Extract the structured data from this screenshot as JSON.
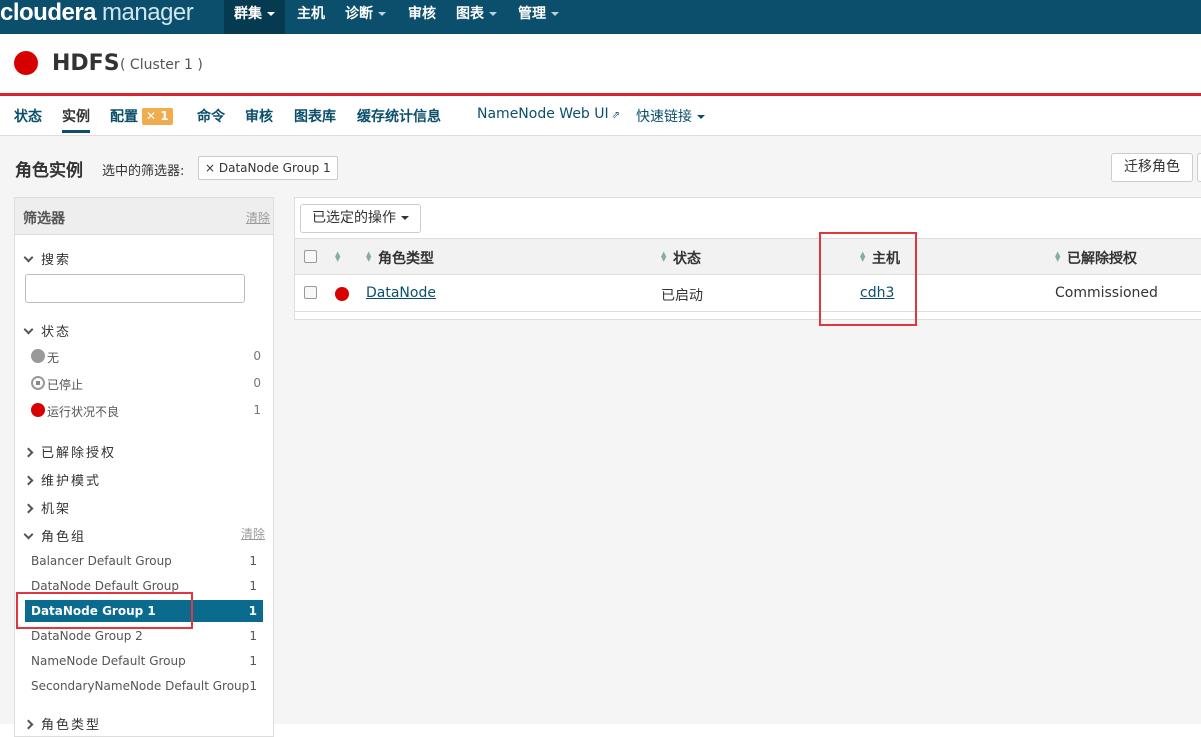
{
  "nav": {
    "brand_main": "cloudera",
    "brand_sub": "manager",
    "items": [
      {
        "label": "群集",
        "has_caret": true,
        "active": true
      },
      {
        "label": "主机",
        "has_caret": false,
        "active": false
      },
      {
        "label": "诊断",
        "has_caret": true,
        "active": false
      },
      {
        "label": "审核",
        "has_caret": false,
        "active": false
      },
      {
        "label": "图表",
        "has_caret": true,
        "active": false
      },
      {
        "label": "管理",
        "has_caret": true,
        "active": false
      }
    ]
  },
  "service": {
    "name": "HDFS",
    "cluster": "( Cluster 1 )",
    "status_color": "#d60000"
  },
  "tabs": {
    "status": "状态",
    "instances": "实例",
    "config": "配置",
    "config_badge": "1",
    "commands": "命令",
    "audit": "审核",
    "charts_lib": "图表库",
    "cache_stats": "缓存统计信息",
    "namenode_ui": "NameNode Web UI",
    "quick_links": "快速链接"
  },
  "page": {
    "title": "角色实例",
    "selected_filters_label": "选中的筛选器:",
    "filter_chip": "× DataNode Group 1",
    "migrate_button": "迁移角色"
  },
  "sidebar": {
    "title": "筛选器",
    "clear": "清除",
    "search_label": "搜索",
    "search_value": "",
    "status_label": "状态",
    "status_items": [
      {
        "label": "无",
        "count": "0",
        "kind": "gray"
      },
      {
        "label": "已停止",
        "count": "0",
        "kind": "stopped"
      },
      {
        "label": "运行状况不良",
        "count": "1",
        "kind": "red"
      }
    ],
    "decommission_label": "已解除授权",
    "maintenance_label": "维护模式",
    "rack_label": "机架",
    "role_group_label": "角色组",
    "role_group_clear": "清除",
    "role_groups": [
      {
        "label": "Balancer Default Group",
        "count": "1"
      },
      {
        "label": "DataNode Default Group",
        "count": "1"
      },
      {
        "label": "DataNode Group 1",
        "count": "1"
      },
      {
        "label": "DataNode Group 2",
        "count": "1"
      },
      {
        "label": "NameNode Default Group",
        "count": "1"
      },
      {
        "label": "SecondaryNameNode Default Group",
        "count": "1"
      }
    ],
    "role_type_label": "角色类型"
  },
  "table": {
    "actions_button": "已选定的操作",
    "headers": {
      "role_type": "角色类型",
      "status": "状态",
      "host": "主机",
      "decommissioned": "已解除授权"
    },
    "rows": [
      {
        "role_type": "DataNode",
        "status": "已启动",
        "host": "cdh3",
        "decommissioned": "Commissioned"
      }
    ]
  },
  "colors": {
    "nav_bg": "#0b4f6c",
    "accent_red": "#d60000",
    "highlight": "#e0363f",
    "active_row": "#0b6b8f"
  }
}
